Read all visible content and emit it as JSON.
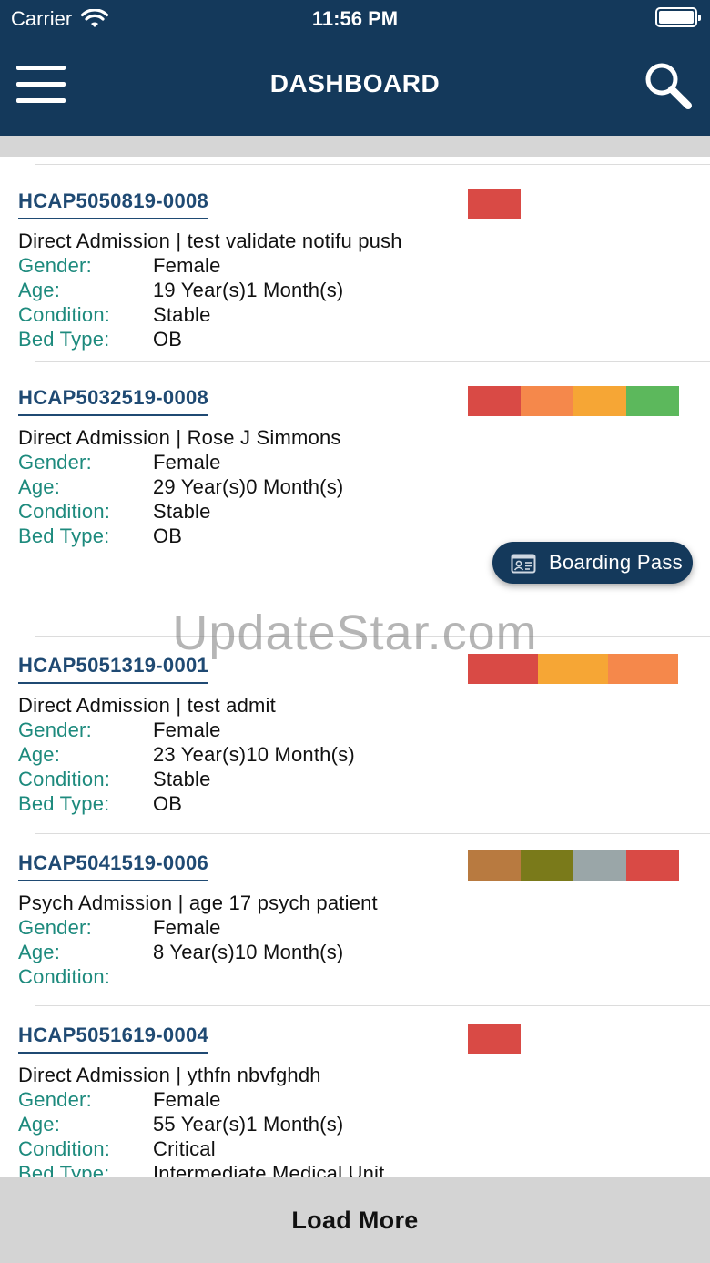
{
  "status_bar": {
    "carrier": "Carrier",
    "time": "11:56 PM"
  },
  "header": {
    "title": "DASHBOARD"
  },
  "labels": {
    "gender": "Gender:",
    "age": "Age:",
    "condition": "Condition:",
    "bed_type": "Bed Type:"
  },
  "patients": [
    {
      "id": "HCAP5050819-0008",
      "admission": "Direct Admission | test validate notifu push",
      "gender": "Female",
      "age": "19 Year(s)1 Month(s)",
      "condition": "Stable",
      "bed_type": "OB",
      "swatches": [
        "#d94a45"
      ]
    },
    {
      "id": "HCAP5032519-0008",
      "admission": "Direct Admission | Rose J Simmons",
      "gender": "Female",
      "age": "29 Year(s)0 Month(s)",
      "condition": "Stable",
      "bed_type": "OB",
      "swatches": [
        "#d94a45",
        "#f5884b",
        "#f6a635",
        "#5cb85c"
      ]
    },
    {
      "id": "HCAP5051319-0001",
      "admission": "Direct Admission | test admit",
      "gender": "Female",
      "age": "23 Year(s)10 Month(s)",
      "condition": "Stable",
      "bed_type": "OB",
      "swatches": [
        "#d94a45",
        "#f6a635",
        "#f5884b"
      ]
    },
    {
      "id": "HCAP5041519-0006",
      "admission": "Psych Admission | age 17 psych patient",
      "gender": "Female",
      "age": "8 Year(s)10 Month(s)",
      "condition": "",
      "bed_type": null,
      "swatches": [
        "#b87a40",
        "#7a7a1a",
        "#9aa6a8",
        "#d94a45"
      ]
    },
    {
      "id": "HCAP5051619-0004",
      "admission": "Direct Admission | ythfn nbvfghdh",
      "gender": "Female",
      "age": "55 Year(s)1 Month(s)",
      "condition": "Critical",
      "bed_type": "Intermediate Medical Unit",
      "swatches": [
        "#d94a45"
      ]
    }
  ],
  "boarding_pass": {
    "label": "Boarding Pass"
  },
  "watermark": "UpdateStar.com",
  "load_more": {
    "label": "Load More"
  }
}
